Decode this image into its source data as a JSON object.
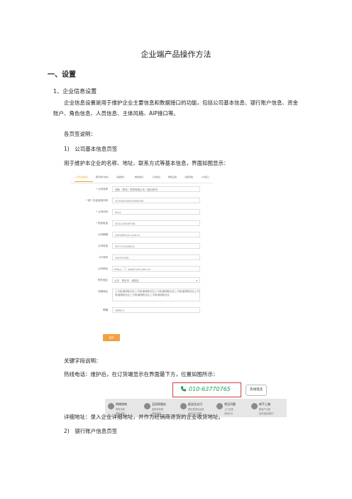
{
  "doc": {
    "title": "企业端产品操作方法",
    "section1": "一、设置",
    "sub1": "1、企业信息设置",
    "para1": "企业信息设置是用于维护企业主要信息和数据接口的功能，包括公司基本信息、银行账户信息、资金账户、角色信息、人员信息、主体风格、AIP接口等。",
    "para2": "各页签说明：",
    "para3": "1)　公司基本信息页签",
    "para4": "用于维护本企业的名称、地址、联系方式等基本信息，界面如图显示：",
    "para5": "关键字段说明：",
    "para6": "热线电话：维护后，在订货端显示在界面最下方，位置如图所示：",
    "para7": "详细地址：录入企业详细地址，并作为经销商退货的企业收货地址。",
    "para8": "2)　银行账户信息页签"
  },
  "shot1": {
    "tabs": [
      "公司基本信息",
      "银行账户信息",
      "资金账户",
      "角色信息",
      "人员信息",
      "角色设置",
      "主题风格",
      "AIP接口"
    ],
    "fields": [
      {
        "label": "* 公司名称",
        "value": "胡秋（青岛）贸易有限公司（演示账号）"
      },
      {
        "label": "* 统一社会信用代码",
        "value": "913100000000000000"
      },
      {
        "label": "* 公司代码",
        "value": "khxx"
      },
      {
        "label": "* 热线电话",
        "value": "0532-55676706"
      },
      {
        "label": "公司邮箱",
        "value": "xxfhz@huch.com.cn"
      },
      {
        "label": "公司传真",
        "value": "0577-52540001"
      },
      {
        "label": "QQ号码",
        "value": "HUCH1928"
      },
      {
        "label": "公司网址",
        "value": "www.huch.com.cn"
      },
      {
        "label": "所在地区",
        "value": "山东 / 青岛市 / 城阳区"
      },
      {
        "label": "详细地址",
        "value": "上马街道胡秋社区上马街道胡秋社区上马街道胡秋社区上马街道胡秋社区上马街道胡秋社区上马街道胡秋社区上马街道胡秋社区"
      },
      {
        "label": "邮编",
        "value": "266011"
      }
    ],
    "url_prefix": "http://",
    "region": {
      "province": "山东",
      "city": "青岛市",
      "district": "城阳区"
    },
    "save": "保存"
  },
  "shot2": {
    "phone": "010-63770765",
    "badge": "热线电话",
    "features": [
      {
        "title": "购物指南",
        "line1": "购物流程",
        "line2": "帮助说明"
      },
      {
        "title": "品质保服务",
        "line1": "退换货政策",
        "line2": "退款说明"
      },
      {
        "title": "配送及支付",
        "line1": "配送范围及运费",
        "line2": "在线支付说明"
      },
      {
        "title": "常见问题",
        "line1": "上门自提",
        "line2": "商品评价"
      },
      {
        "title": "新手上路",
        "line1": "新用户注册",
        "line2": "如何找回密码？"
      }
    ]
  },
  "colors": {
    "accent": "#f0a030",
    "phone": "#1aa05a",
    "highlight_border": "#d04040"
  }
}
